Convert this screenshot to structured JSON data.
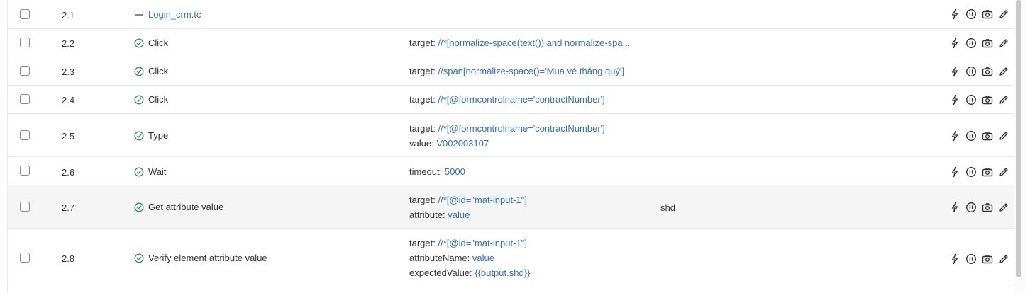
{
  "colors": {
    "link": "#2f6fd6",
    "check": "#2e8b57",
    "highlight_row": "#f5f5f5"
  },
  "rows": [
    {
      "num": "2.1",
      "action": "Login_crm.tc",
      "kind": "group",
      "params": [],
      "output": ""
    },
    {
      "num": "2.2",
      "action": "Click",
      "kind": "step",
      "params": [
        {
          "key": "target:",
          "value": "//*[normalize-space(text()) and normalize-spa..."
        }
      ],
      "output": ""
    },
    {
      "num": "2.3",
      "action": "Click",
      "kind": "step",
      "params": [
        {
          "key": "target:",
          "value": "//span[normalize-space()='Mua vé tháng quý']"
        }
      ],
      "output": ""
    },
    {
      "num": "2.4",
      "action": "Click",
      "kind": "step",
      "params": [
        {
          "key": "target:",
          "value": "//*[@formcontrolname='contractNumber']"
        }
      ],
      "output": ""
    },
    {
      "num": "2.5",
      "action": "Type",
      "kind": "step",
      "params": [
        {
          "key": "target:",
          "value": "//*[@formcontrolname='contractNumber']"
        },
        {
          "key": "value:",
          "value": "V002003107"
        }
      ],
      "output": ""
    },
    {
      "num": "2.6",
      "action": "Wait",
      "kind": "step",
      "params": [
        {
          "key": "timeout:",
          "value": "5000"
        }
      ],
      "output": ""
    },
    {
      "num": "2.7",
      "action": "Get attribute value",
      "kind": "step",
      "params": [
        {
          "key": "target:",
          "value": "//*[@id=\"mat-input-1\"]"
        },
        {
          "key": "attribute:",
          "value": "value"
        }
      ],
      "output": "shd"
    },
    {
      "num": "2.8",
      "action": "Verify element attribute value",
      "kind": "step",
      "params": [
        {
          "key": "target:",
          "value": "//*[@id=\"mat-input-1\"]"
        },
        {
          "key": "attributeName:",
          "value": "value"
        },
        {
          "key": "expectedValue:",
          "value": "{{output.shd}}"
        }
      ],
      "output": ""
    }
  ],
  "row_tools": [
    "flash-icon",
    "pause-icon",
    "camera-icon",
    "edit-icon"
  ]
}
